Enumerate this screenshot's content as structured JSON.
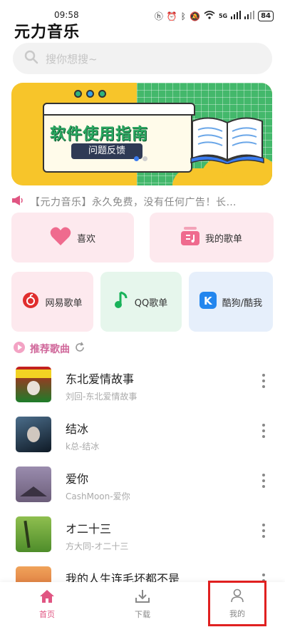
{
  "status": {
    "time": "09:58",
    "signal": "5G",
    "battery": "84"
  },
  "app": {
    "title": "元力音乐"
  },
  "search": {
    "placeholder": "搜你想搜~"
  },
  "banner": {
    "headline": "软件使用指南",
    "button_label": "问题反馈",
    "page_count": 2,
    "active_page": 1
  },
  "notice": {
    "text": "【元力音乐】永久免费，没有任何广告！长…"
  },
  "shortcuts": {
    "like_label": "喜欢",
    "playlist_label": "我的歌单"
  },
  "sources": [
    {
      "label": "网易歌单",
      "color": "#e02e2e"
    },
    {
      "label": "QQ歌单",
      "color": "#19b25a"
    },
    {
      "label": "酷狗/酷我",
      "color": "#2386ee"
    }
  ],
  "recommend": {
    "title": "推荐歌曲"
  },
  "songs": [
    {
      "title": "东北爱情故事",
      "subtitle": "刘回-东北爱情故事"
    },
    {
      "title": "结冰",
      "subtitle": "k总-结冰"
    },
    {
      "title": "爱你",
      "subtitle": "CashMoon-爱你"
    },
    {
      "title": "オ二十三",
      "subtitle": "方大同-オ二十三"
    },
    {
      "title": "我的人生连毛坏都不是",
      "subtitle": ""
    }
  ],
  "tabs": {
    "home": "首页",
    "download": "下载",
    "mine": "我的"
  },
  "colors": {
    "accent": "#e05582",
    "highlight_box": "#e02020"
  }
}
